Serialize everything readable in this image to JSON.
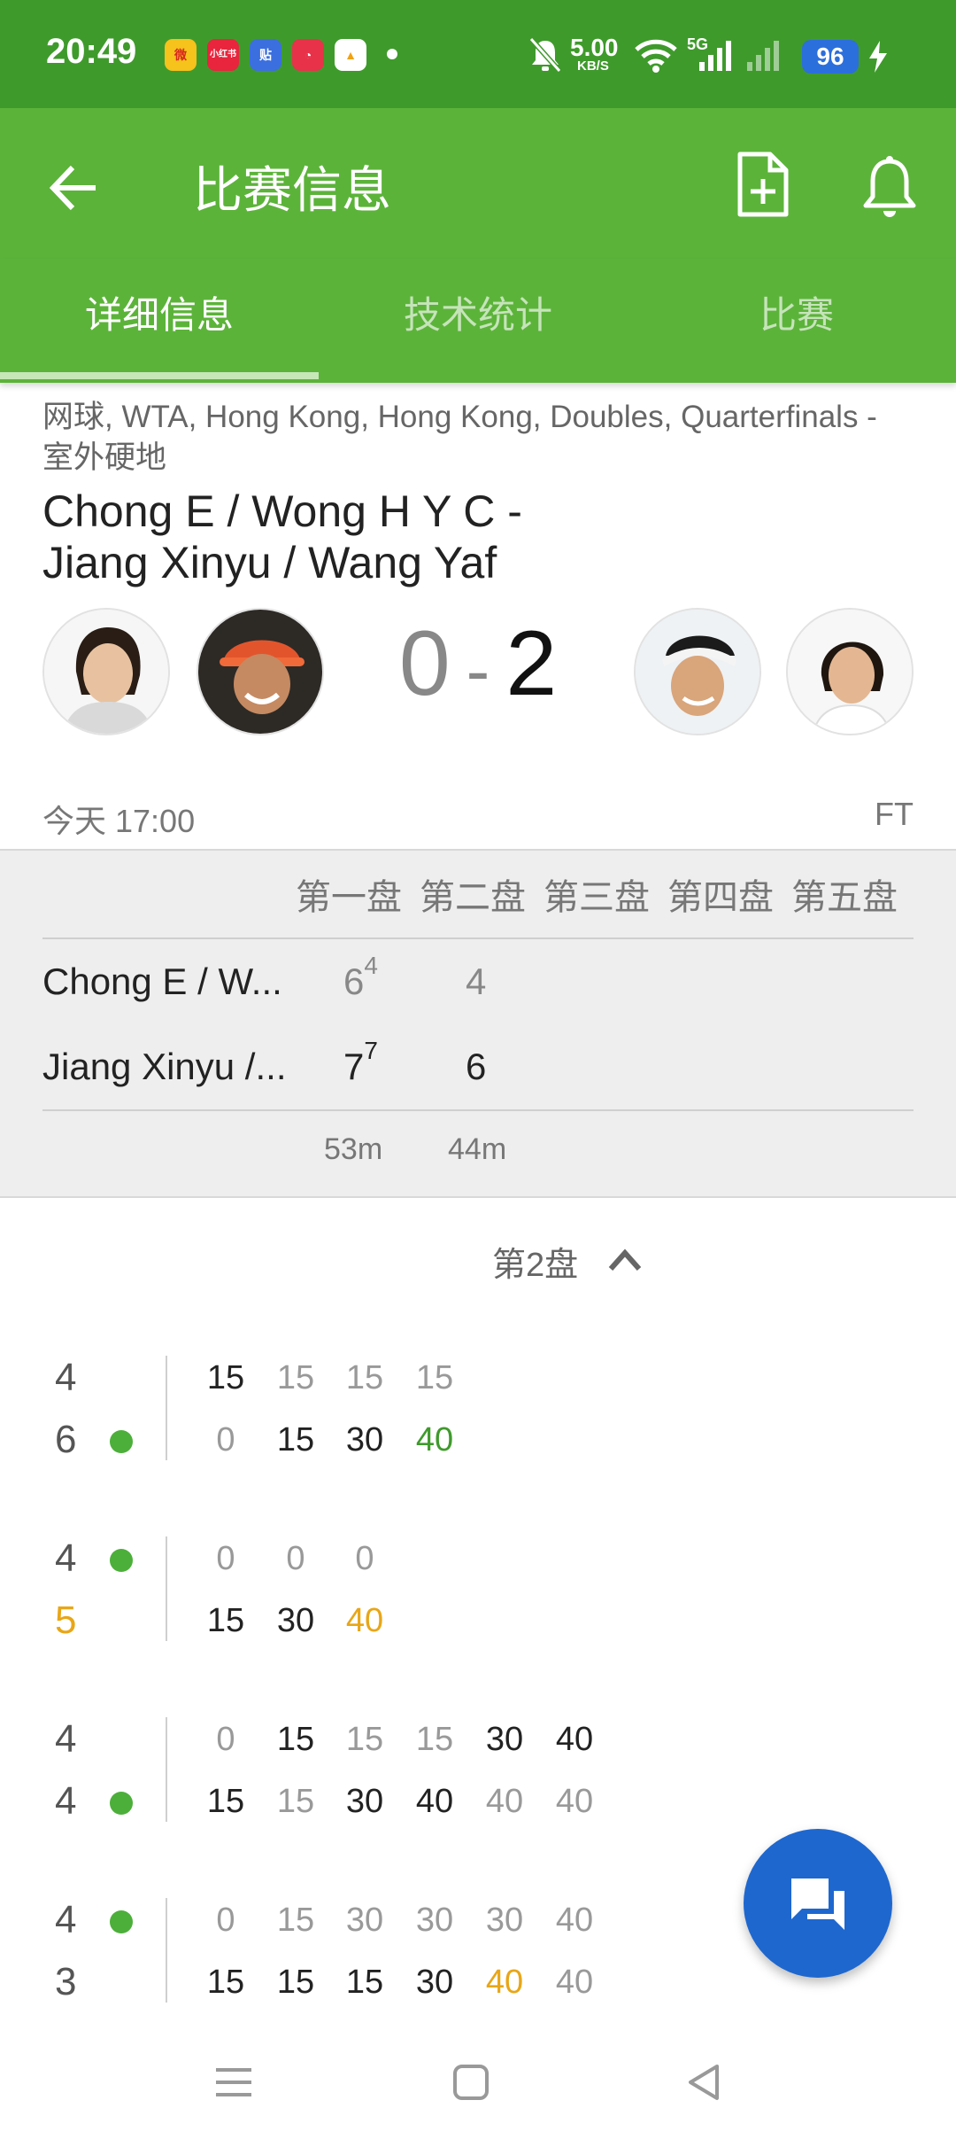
{
  "status_bar": {
    "time": "20:49",
    "apps": [
      "微",
      "小红书",
      "贴",
      "◔",
      "▲"
    ],
    "net_speed": "5.00",
    "net_unit": "KB/S",
    "network": "5G",
    "battery": "96"
  },
  "app_bar": {
    "title": "比赛信息",
    "back_icon": "arrow-back-icon",
    "actions": [
      "add-document-icon",
      "bell-icon"
    ]
  },
  "tabs": [
    {
      "label": "详细信息",
      "active": true
    },
    {
      "label": "技术统计",
      "active": false
    },
    {
      "label": "比赛",
      "active": false
    }
  ],
  "match": {
    "meta": "网球, WTA, Hong Kong, Hong Kong, Doubles, Quarterfinals - 室外硬地",
    "title_line1": "Chong E / Wong H Y C -",
    "title_line2": "Jiang Xinyu / Wang Yaf",
    "score_home": "0",
    "score_sep": "-",
    "score_away": "2",
    "start_time": "今天 17:00",
    "status": "FT"
  },
  "sets": {
    "headers": [
      "第一盘",
      "第二盘",
      "第三盘",
      "第四盘",
      "第五盘"
    ],
    "teams": [
      {
        "name": "Chong E / W...",
        "scores": [
          {
            "games": "6",
            "tb": "4"
          },
          {
            "games": "4",
            "tb": ""
          }
        ]
      },
      {
        "name": "Jiang Xinyu /...",
        "scores": [
          {
            "games": "7",
            "tb": "7"
          },
          {
            "games": "6",
            "tb": ""
          }
        ]
      }
    ],
    "durations": [
      "53m",
      "44m"
    ]
  },
  "set_selector": {
    "label": "第2盘"
  },
  "games": [
    {
      "home_games": "4",
      "away_games": "6",
      "server": "away",
      "away_highlight": false,
      "home_points": [
        "15",
        "15",
        "15",
        "15"
      ],
      "away_points": [
        "0",
        "15",
        "30",
        "40"
      ]
    },
    {
      "home_games": "4",
      "away_games": "5",
      "server": "home",
      "away_highlight": true,
      "home_points": [
        "0",
        "0",
        "0"
      ],
      "away_points": [
        "15",
        "30",
        "40"
      ]
    },
    {
      "home_games": "4",
      "away_games": "4",
      "server": "away",
      "away_highlight": false,
      "home_points": [
        "0",
        "15",
        "15",
        "15",
        "30",
        "40"
      ],
      "away_points": [
        "15",
        "15",
        "30",
        "40",
        "40",
        "40"
      ]
    },
    {
      "home_games": "4",
      "away_games": "3",
      "server": "home",
      "away_highlight": false,
      "home_points": [
        "0",
        "15",
        "30",
        "30",
        "30",
        "40"
      ],
      "away_points": [
        "15",
        "15",
        "15",
        "30",
        "40",
        "40"
      ]
    }
  ],
  "colors": {
    "status_bar": "#3f9a2c",
    "app_bar": "#5cb33a",
    "serve_dot": "#4caf3a",
    "break_point": "#e8a617",
    "fab": "#1e67cf"
  }
}
